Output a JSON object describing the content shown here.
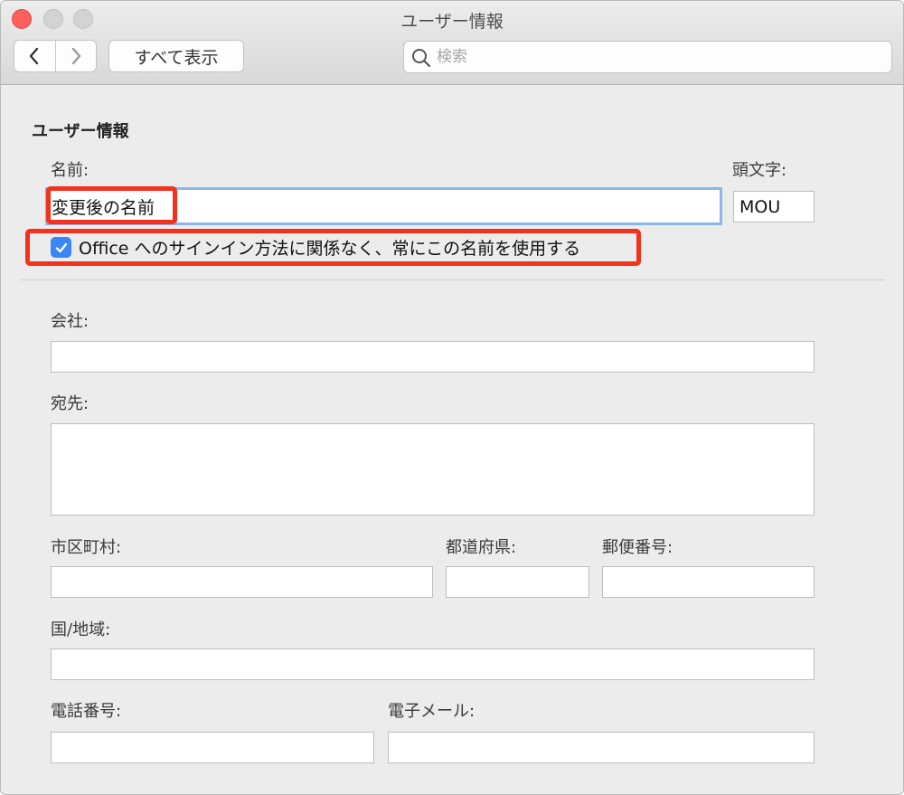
{
  "window": {
    "title": "ユーザー情報"
  },
  "toolbar": {
    "show_all_label": "すべて表示"
  },
  "search": {
    "placeholder": "検索"
  },
  "section": {
    "title": "ユーザー情報"
  },
  "name": {
    "label": "名前:",
    "value": "変更後の名前"
  },
  "initials": {
    "label": "頭文字:",
    "value": "MOU"
  },
  "always_use_name": {
    "checked": true,
    "label": "Office へのサインイン方法に関係なく、常にこの名前を使用する"
  },
  "company": {
    "label": "会社:",
    "value": ""
  },
  "address": {
    "label": "宛先:",
    "value": ""
  },
  "city": {
    "label": "市区町村:",
    "value": ""
  },
  "prefecture": {
    "label": "都道府県:",
    "value": ""
  },
  "postal_code": {
    "label": "郵便番号:",
    "value": ""
  },
  "country": {
    "label": "国/地域:",
    "value": ""
  },
  "phone": {
    "label": "電話番号:",
    "value": ""
  },
  "email": {
    "label": "電子メール:",
    "value": ""
  },
  "colors": {
    "highlight": "#f3321e",
    "checkbox": "#3b86f7",
    "focus_ring": "#8cb5ec"
  }
}
